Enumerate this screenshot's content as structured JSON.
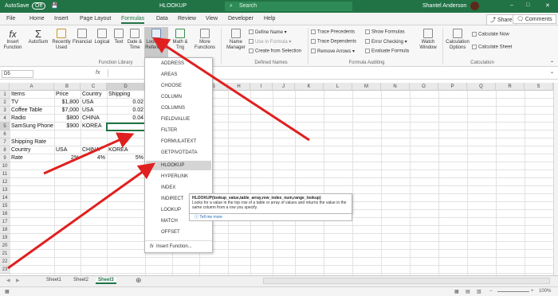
{
  "title_bar": {
    "autosave_label": "AutoSave",
    "autosave_state": "Off",
    "file_name": "HLOOKUP",
    "search_placeholder": "Search",
    "user_name": "Shantel Anderson"
  },
  "tabs": [
    "File",
    "Home",
    "Insert",
    "Page Layout",
    "Formulas",
    "Data",
    "Review",
    "View",
    "Developer",
    "Help"
  ],
  "active_tab": "Formulas",
  "share_label": "Share",
  "comments_label": "Comments",
  "ribbon": {
    "insert_function": "Insert\nFunction",
    "autosum": "AutoSum",
    "recently_used": "Recently\nUsed",
    "financial": "Financial",
    "logical": "Logical",
    "text": "Text",
    "date_time": "Date &\nTime",
    "lookup_reference": "Lookup &\nReference",
    "math_trig": "Math &\nTrig",
    "more_functions": "More\nFunctions",
    "function_library": "Function Library",
    "name_manager": "Name\nManager",
    "define_name": "Define Name",
    "use_in_formula": "Use in Formula",
    "create_from_selection": "Create from Selection",
    "defined_names": "Defined Names",
    "trace_precedents": "Trace Precedents",
    "trace_dependents": "Trace Dependents",
    "remove_arrows": "Remove Arrows",
    "show_formulas": "Show Formulas",
    "error_checking": "Error Checking",
    "evaluate_formula": "Evaluate Formula",
    "formula_auditing": "Formula Auditing",
    "watch_window": "Watch\nWindow",
    "calculation_options": "Calculation\nOptions",
    "calculate_now": "Calculate Now",
    "calculate_sheet": "Calculate Sheet",
    "calculation": "Calculation"
  },
  "name_box": "D5",
  "formula_bar_fx": "fx",
  "columns": [
    "A",
    "B",
    "C",
    "D",
    "E",
    "F",
    "G",
    "H",
    "I",
    "J",
    "K",
    "L",
    "M",
    "N",
    "O",
    "P",
    "Q",
    "R",
    "S"
  ],
  "rows": [
    "1",
    "2",
    "3",
    "4",
    "5",
    "6",
    "7",
    "8",
    "9",
    "10",
    "11",
    "12",
    "13",
    "14",
    "15",
    "16",
    "17",
    "18",
    "19",
    "20",
    "21",
    "22",
    "23"
  ],
  "cells": {
    "a1": "Items",
    "b1": "Price",
    "c1": "Country",
    "d1": "Shipping",
    "a2": "TV",
    "b2": "$1,800",
    "c2": "USA",
    "d2": "0.02",
    "a3": "Coffee Table",
    "b3": "$7,000",
    "c3": "USA",
    "d3": "0.02",
    "a4": "Radio",
    "b4": "$800",
    "c4": "CHINA",
    "d4": "0.04",
    "a5": "SamSung Phone",
    "b5": "$900",
    "c5": "KOREA",
    "a7": "Shipping Rate",
    "a8": "Country",
    "b8": "USA",
    "c8": "CHINA",
    "d8": "KOREA",
    "a9": "Rate",
    "b9": "2%",
    "c9": "4%",
    "d9": "5%"
  },
  "lookup_menu": [
    "ADDRESS",
    "AREAS",
    "CHOOSE",
    "COLUMN",
    "COLUMNS",
    "FIELDVALUE",
    "FILTER",
    "FORMULATEXT",
    "GETPIVOTDATA",
    "HLOOKUP",
    "HYPERLINK",
    "INDEX",
    "INDIRECT",
    "LOOKUP",
    "MATCH",
    "OFFSET"
  ],
  "insert_function_item": "Insert Function...",
  "tooltip": {
    "signature": "HLOOKUP(lookup_value,table_array,row_index_num,range_lookup)",
    "description": "Looks for a value in the top row of a table or array of values and returns the value in the same column from a row you specify.",
    "tell_me_more": "Tell me more"
  },
  "sheets": [
    "Sheet1",
    "Sheet2",
    "Sheet3"
  ],
  "active_sheet": "Sheet3",
  "zoom": "100%",
  "colors": {
    "excel_green": "#217346",
    "arrow_red": "#e02020",
    "menu_highlight": "#d5d5d5"
  }
}
